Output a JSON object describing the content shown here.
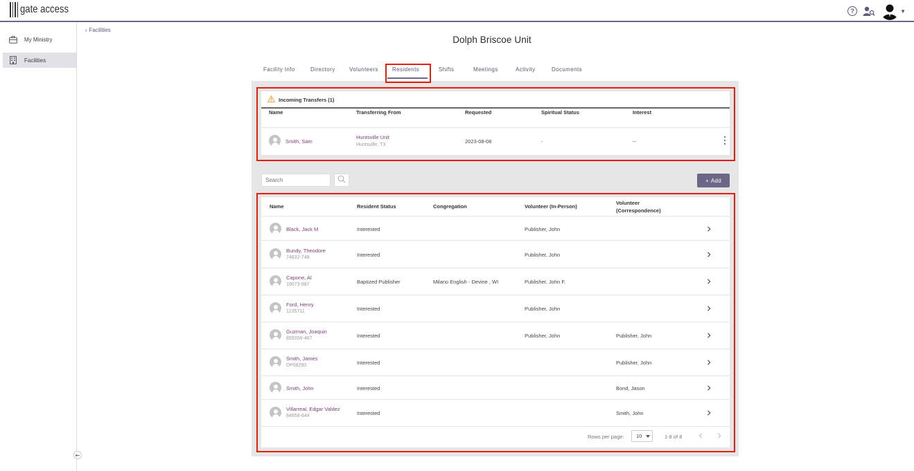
{
  "app": {
    "logo_text": "gate access"
  },
  "sidebar": {
    "items": [
      {
        "label": "My Ministry",
        "icon": "briefcase-icon"
      },
      {
        "label": "Facilities",
        "icon": "building-icon",
        "active": true
      }
    ]
  },
  "breadcrumb": {
    "back_label": "Facilities"
  },
  "page": {
    "title": "Dolph Briscoe Unit"
  },
  "tabs": [
    {
      "label": "Facility Info"
    },
    {
      "label": "Directory"
    },
    {
      "label": "Volunteers"
    },
    {
      "label": "Residents",
      "active": true
    },
    {
      "label": "Shifts"
    },
    {
      "label": "Meetings"
    },
    {
      "label": "Activity"
    },
    {
      "label": "Documents"
    }
  ],
  "transfers": {
    "title": "Incoming Transfers (1)",
    "columns": [
      "Name",
      "Transferring From",
      "Requested",
      "Spiritual Status",
      "Interest"
    ],
    "rows": [
      {
        "name": "Smith, Sam",
        "from": "Huntsville Unit",
        "from_location": "Huntsville, TX",
        "requested": "2023-08-08",
        "spiritual_status": "-",
        "interest": "--"
      }
    ]
  },
  "search": {
    "placeholder": "Search"
  },
  "add_button": {
    "label": "Add"
  },
  "residents": {
    "columns": [
      "Name",
      "Resident Status",
      "Congregation",
      "Volunteer (In-Person)",
      "Volunteer",
      "(Correspondence)"
    ],
    "rows": [
      {
        "name": "Black, Jack M",
        "id": "",
        "status": "Interested",
        "congregation": "",
        "volunteer_in_person": "Publisher, John",
        "volunteer_correspondence": ""
      },
      {
        "name": "Bundy, Theodore",
        "id": "74832-748",
        "status": "Interested",
        "congregation": "",
        "volunteer_in_person": "Publisher, John",
        "volunteer_correspondence": ""
      },
      {
        "name": "Capone, Al",
        "id": "19073-987",
        "status": "Baptized Publisher",
        "congregation": "Milano English - Devine , WI",
        "volunteer_in_person": "Publisher, John F.",
        "volunteer_correspondence": ""
      },
      {
        "name": "Ford, Henry",
        "id": "1235711",
        "status": "Interested",
        "congregation": "",
        "volunteer_in_person": "Publisher, John",
        "volunteer_correspondence": ""
      },
      {
        "name": "Guzman, Joaquin",
        "id": "859356-467",
        "status": "Interested",
        "congregation": "",
        "volunteer_in_person": "Publisher, John",
        "volunteer_correspondence": "Publisher, John"
      },
      {
        "name": "Smith, James",
        "id": "DP08293",
        "status": "Interested",
        "congregation": "",
        "volunteer_in_person": "",
        "volunteer_correspondence": "Publisher, John"
      },
      {
        "name": "Smith, John",
        "id": "",
        "status": "Interested",
        "congregation": "",
        "volunteer_in_person": "",
        "volunteer_correspondence": "Bond, Jason"
      },
      {
        "name": "Villarreal, Edgar Valdez",
        "id": "84858-844",
        "status": "Interested",
        "congregation": "",
        "volunteer_in_person": "",
        "volunteer_correspondence": "Smith, John"
      }
    ]
  },
  "pagination": {
    "rows_per_page_label": "Rows per page:",
    "rows_per_page": "10",
    "range": "1-8 of 8"
  },
  "colors": {
    "accent": "#6d6787",
    "link": "#7b3f7a",
    "highlight": "#ea1c0d",
    "warning": "#f0a030"
  }
}
